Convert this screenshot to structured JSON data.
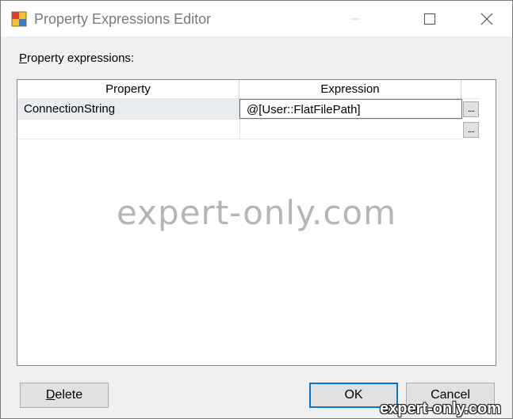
{
  "window": {
    "title": "Property Expressions Editor",
    "icon": "ssis-package-icon"
  },
  "section_label": {
    "prefix": "P",
    "rest": "roperty expressions:"
  },
  "grid": {
    "columns": [
      "Property",
      "Expression"
    ],
    "rows": [
      {
        "property": "ConnectionString",
        "expression": "@[User::FlatFilePath]"
      },
      {
        "property": "",
        "expression": ""
      }
    ],
    "ellipsis_label": "...."
  },
  "watermark": "expert-only.com",
  "buttons": {
    "delete": {
      "prefix": "D",
      "rest": "elete"
    },
    "ok": "OK",
    "cancel": "Cancel"
  },
  "footer_brand": "expert-only.com",
  "colors": {
    "accent": "#0078d7",
    "selection": "#e8ecf1"
  }
}
